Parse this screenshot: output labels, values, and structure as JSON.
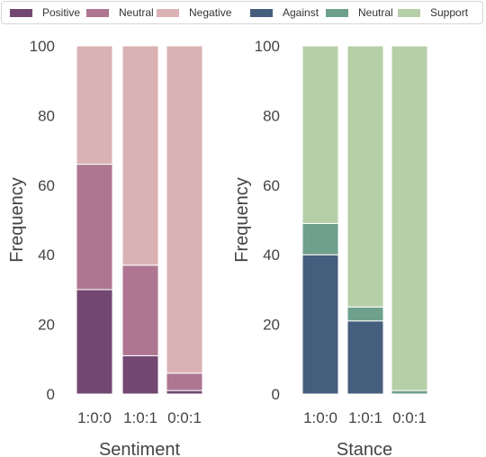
{
  "legend": {
    "items": [
      {
        "label": "Positive",
        "color": "#724872"
      },
      {
        "label": "Neutral",
        "color": "#ae7691"
      },
      {
        "label": "Negative",
        "color": "#dab2b3"
      },
      {
        "label": "Against",
        "color": "#465e7d"
      },
      {
        "label": "Neutral",
        "color": "#6ea08c"
      },
      {
        "label": "Support",
        "color": "#b6cfa8"
      }
    ]
  },
  "chart_data": [
    {
      "type": "bar",
      "stacked": true,
      "title": "",
      "xlabel": "Sentiment",
      "ylabel": "Frequency",
      "ylim": [
        0,
        100
      ],
      "yticks": [
        0,
        20,
        40,
        60,
        80,
        100
      ],
      "grid": false,
      "categories": [
        "1:0:0",
        "1:0:1",
        "0:0:1"
      ],
      "series": [
        {
          "name": "Positive",
          "color": "#724872",
          "values": [
            30,
            11,
            1
          ]
        },
        {
          "name": "Neutral",
          "color": "#ae7691",
          "values": [
            36,
            26,
            5
          ]
        },
        {
          "name": "Negative",
          "color": "#dab2b3",
          "values": [
            34,
            63,
            94
          ]
        }
      ]
    },
    {
      "type": "bar",
      "stacked": true,
      "title": "",
      "xlabel": "Stance",
      "ylabel": "Frequency",
      "ylim": [
        0,
        100
      ],
      "yticks": [
        0,
        20,
        40,
        60,
        80,
        100
      ],
      "grid": false,
      "categories": [
        "1:0:0",
        "1:0:1",
        "0:0:1"
      ],
      "series": [
        {
          "name": "Against",
          "color": "#465e7d",
          "values": [
            40,
            21,
            0
          ]
        },
        {
          "name": "Neutral",
          "color": "#6ea08c",
          "values": [
            9,
            4,
            1
          ]
        },
        {
          "name": "Support",
          "color": "#b6cfa8",
          "values": [
            51,
            75,
            99
          ]
        }
      ]
    }
  ]
}
